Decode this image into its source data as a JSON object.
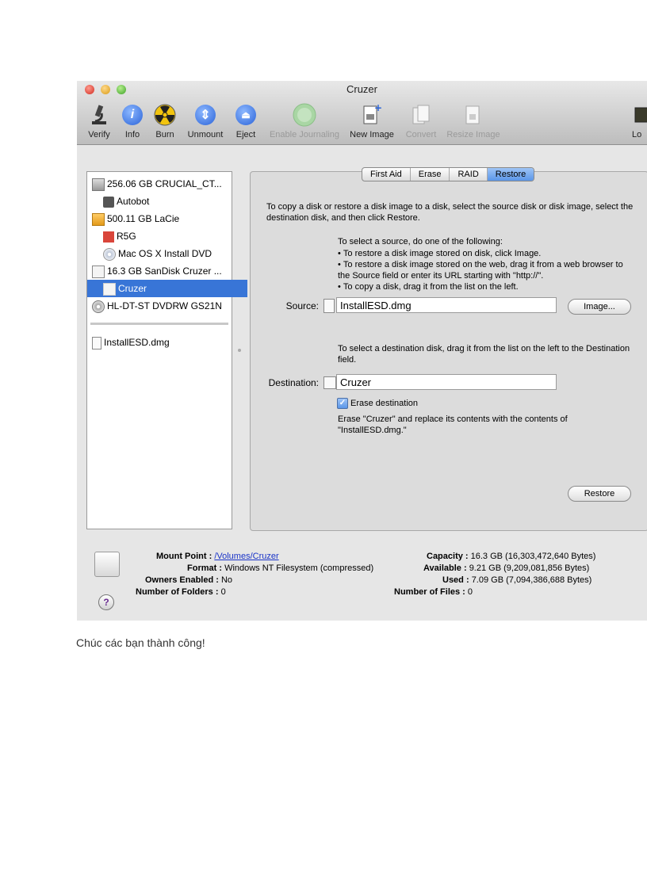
{
  "window": {
    "title": "Cruzer",
    "toolbar": [
      {
        "label": "Verify",
        "icon": "microscope-icon",
        "enabled": true
      },
      {
        "label": "Info",
        "icon": "info-icon",
        "enabled": true
      },
      {
        "label": "Burn",
        "icon": "burn-radiation-icon",
        "enabled": true
      },
      {
        "label": "Unmount",
        "icon": "unmount-icon",
        "enabled": true
      },
      {
        "label": "Eject",
        "icon": "eject-icon",
        "enabled": true
      },
      {
        "label": "Enable Journaling",
        "icon": "journaling-icon",
        "enabled": false
      },
      {
        "label": "New Image",
        "icon": "new-image-icon",
        "enabled": true
      },
      {
        "label": "Convert",
        "icon": "convert-icon",
        "enabled": false
      },
      {
        "label": "Resize Image",
        "icon": "resize-image-icon",
        "enabled": false
      },
      {
        "label": "Lo",
        "icon": "log-icon",
        "enabled": true
      }
    ]
  },
  "sidebar": {
    "items": [
      {
        "label": "256.06 GB CRUCIAL_CT...",
        "indent": 0,
        "icon": "hard-disk-icon"
      },
      {
        "label": "Autobot",
        "indent": 1,
        "icon": "autobot-volume-icon"
      },
      {
        "label": "500.11 GB LaCie",
        "indent": 0,
        "icon": "external-disk-icon"
      },
      {
        "label": "R5G",
        "indent": 1,
        "icon": "r5g-volume-icon"
      },
      {
        "label": "Mac OS X Install DVD",
        "indent": 1,
        "icon": "install-dvd-icon"
      },
      {
        "label": "16.3 GB SanDisk Cruzer ...",
        "indent": 0,
        "icon": "usb-disk-icon"
      },
      {
        "label": "Cruzer",
        "indent": 1,
        "icon": "volume-icon",
        "selected": true
      },
      {
        "label": "HL-DT-ST DVDRW GS21N",
        "indent": 0,
        "icon": "dvd-drive-icon"
      }
    ],
    "images": [
      {
        "label": "InstallESD.dmg",
        "icon": "dmg-file-icon"
      }
    ]
  },
  "tabs": [
    {
      "label": "First Aid",
      "active": false
    },
    {
      "label": "Erase",
      "active": false
    },
    {
      "label": "RAID",
      "active": false
    },
    {
      "label": "Restore",
      "active": true
    }
  ],
  "restore": {
    "intro": "To copy a disk or restore a disk image to a disk, select the source disk or disk image, select the destination disk, and then click Restore.",
    "source_help_title": "To select a source, do one of the following:",
    "source_help_items": [
      "To restore a disk image stored on disk, click Image.",
      "To restore a disk image stored on the web, drag it from a web browser to the Source field or enter its URL starting with \"http://\".",
      "To copy a disk, drag it from the list on the left."
    ],
    "source_label": "Source:",
    "source_value": "InstallESD.dmg",
    "image_button": "Image...",
    "dest_help": "To select a destination disk, drag it from the list on the left to the Destination field.",
    "dest_label": "Destination:",
    "dest_value": "Cruzer",
    "erase_label": "Erase destination",
    "erase_checked": true,
    "erase_note": "Erase \"Cruzer\" and replace its contents with the contents of \"InstallESD.dmg.\"",
    "restore_button": "Restore"
  },
  "info": {
    "mount_point_label": "Mount Point :",
    "mount_point_value": "/Volumes/Cruzer",
    "format_label": "Format :",
    "format_value": "Windows NT Filesystem (compressed)",
    "owners_label": "Owners Enabled :",
    "owners_value": "No",
    "folders_label": "Number of Folders :",
    "folders_value": "0",
    "capacity_label": "Capacity :",
    "capacity_value": "16.3 GB (16,303,472,640 Bytes)",
    "available_label": "Available :",
    "available_value": "9.21 GB (9,209,081,856 Bytes)",
    "used_label": "Used :",
    "used_value": "7.09 GB (7,094,386,688 Bytes)",
    "files_label": "Number of Files :",
    "files_value": "0"
  },
  "caption": "Chúc các bạn thành công!"
}
